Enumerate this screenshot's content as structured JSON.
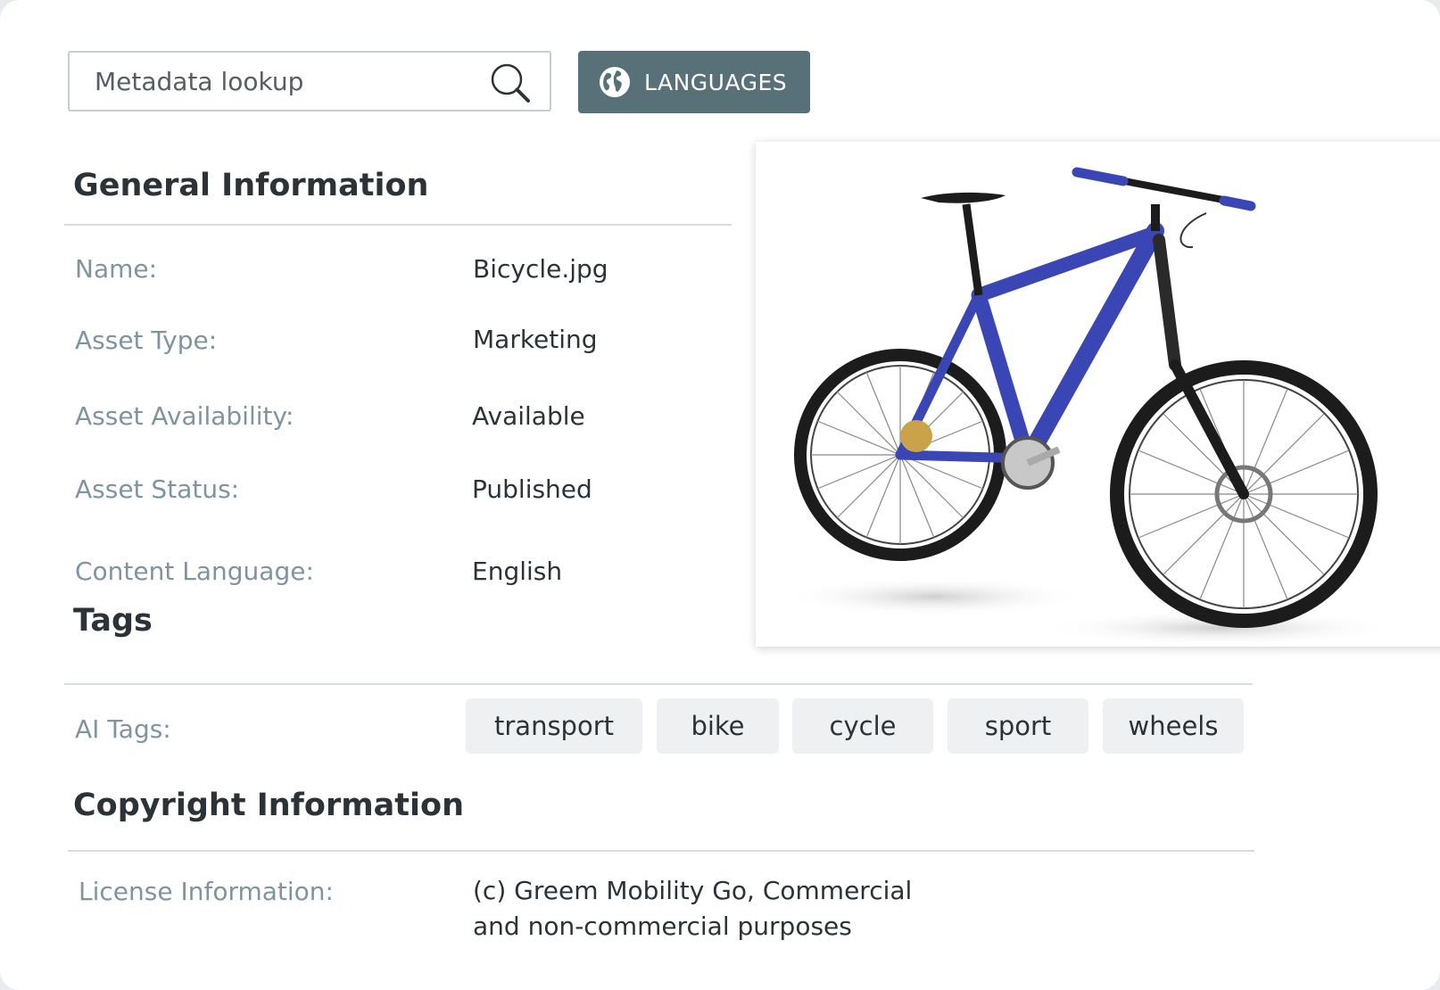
{
  "search": {
    "placeholder": "Metadata lookup"
  },
  "languages_button": {
    "label": "LANGUAGES"
  },
  "general": {
    "title": "General Information",
    "fields": [
      {
        "label": "Name:",
        "value": "Bicycle.jpg"
      },
      {
        "label": "Asset Type:",
        "value": "Marketing"
      },
      {
        "label": "Asset Availability:",
        "value": "Available"
      },
      {
        "label": "Asset Status:",
        "value": "Published"
      },
      {
        "label": "Content Language:",
        "value": "English"
      }
    ]
  },
  "tags": {
    "title": "Tags",
    "ai_label": "AI Tags:",
    "items": [
      "transport",
      "bike",
      "cycle",
      "sport",
      "wheels"
    ]
  },
  "copyright": {
    "title": "Copyright Information",
    "license_label": "License Information:",
    "license_line1": "(c) Greem Mobility Go, Commercial",
    "license_line2": "and non-commercial purposes"
  },
  "colors": {
    "button_bg": "#587078",
    "label": "#7e949f",
    "bike_frame": "#3a46b4"
  },
  "image": {
    "subject": "blue mountain bicycle"
  }
}
